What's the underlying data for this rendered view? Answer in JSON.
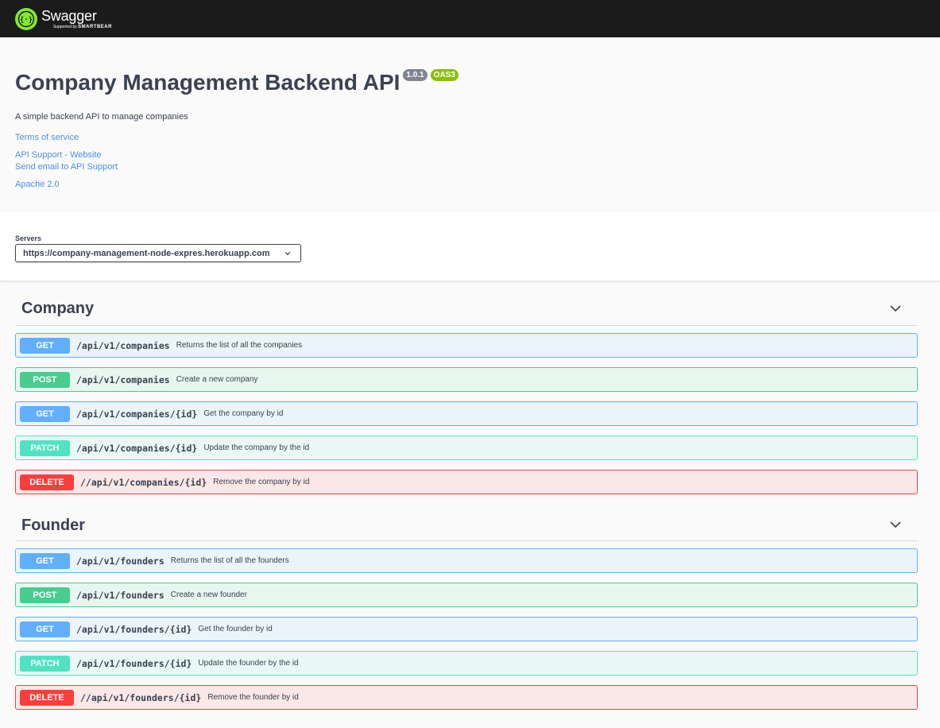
{
  "topbar": {
    "logo_name": "Swagger",
    "logo_sub_prefix": "Supported by",
    "logo_sub_brand": "SMARTBEAR",
    "logo_color": "#85ea2d"
  },
  "info": {
    "title": "Company Management Backend API",
    "version": "1.0.1",
    "oas": "OAS3",
    "description": "A simple backend API to manage companies",
    "links": {
      "terms": "Terms of service",
      "website": "API Support - Website",
      "email": "Send email to API Support",
      "license": "Apache 2.0"
    }
  },
  "servers": {
    "label": "Servers",
    "selected": "https://company-management-node-expres.herokuapp.com"
  },
  "tags": [
    {
      "name": "Company",
      "operations": [
        {
          "method": "GET",
          "path": "/api/v1/companies",
          "summary": "Returns the list of all the companies"
        },
        {
          "method": "POST",
          "path": "/api/v1/companies",
          "summary": "Create a new company"
        },
        {
          "method": "GET",
          "path": "/api/v1/companies/{id}",
          "summary": "Get the company by id"
        },
        {
          "method": "PATCH",
          "path": "/api/v1/companies/{id}",
          "summary": "Update the company by the id"
        },
        {
          "method": "DELETE",
          "path": "//api/v1/companies/{id}",
          "summary": "Remove the company by id"
        }
      ]
    },
    {
      "name": "Founder",
      "operations": [
        {
          "method": "GET",
          "path": "/api/v1/founders",
          "summary": "Returns the list of all the founders"
        },
        {
          "method": "POST",
          "path": "/api/v1/founders",
          "summary": "Create a new founder"
        },
        {
          "method": "GET",
          "path": "/api/v1/founders/{id}",
          "summary": "Get the founder by id"
        },
        {
          "method": "PATCH",
          "path": "/api/v1/founders/{id}",
          "summary": "Update the founder by the id"
        },
        {
          "method": "DELETE",
          "path": "//api/v1/founders/{id}",
          "summary": "Remove the founder by id"
        }
      ]
    }
  ],
  "colors": {
    "get": "#61affe",
    "post": "#49cc90",
    "patch": "#50e3c2",
    "delete": "#f93e3e",
    "link": "#4990e2"
  }
}
